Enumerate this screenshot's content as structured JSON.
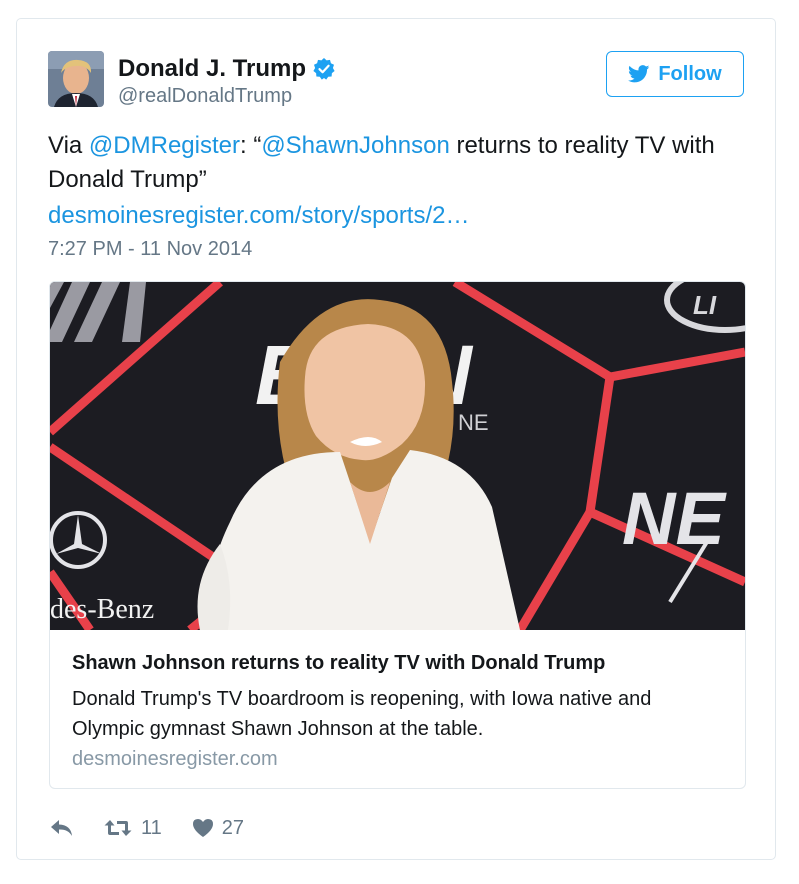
{
  "author": {
    "display_name": "Donald J. Trump",
    "handle": "@realDonaldTrump",
    "verified": true
  },
  "follow_button": {
    "label": "Follow",
    "icon": "twitter-bird-icon"
  },
  "tweet": {
    "prefix": "Via ",
    "mention_source": "@DMRegister",
    "colon_quote": ": “",
    "mention_subject": "@ShawnJohnson",
    "body": " returns to reality TV with Donald Trump”",
    "link_text": "desmoinesregister.com/story/sports/2…",
    "timestamp": "7:27 PM - 11 Nov 2014"
  },
  "card": {
    "title": "Shawn Johnson returns to reality TV with Donald Trump",
    "description": "Donald Trump's TV boardroom is reopening, with Iowa native and Olympic gymnast Shawn Johnson at the table.",
    "domain": "desmoinesregister.com",
    "image_texts": {
      "espn": "ESPN",
      "sponsor": "des-Benz",
      "next": "NE"
    }
  },
  "actions": {
    "reply_icon": "reply-icon",
    "retweet_icon": "retweet-icon",
    "retweet_count": "11",
    "like_icon": "heart-icon",
    "like_count": "27"
  },
  "colors": {
    "link_blue": "#1b95e0",
    "twitter_blue": "#1da1f2",
    "muted_gray": "#657786",
    "backdrop_red": "#e8414a",
    "backdrop_dark": "#1c1c22"
  }
}
